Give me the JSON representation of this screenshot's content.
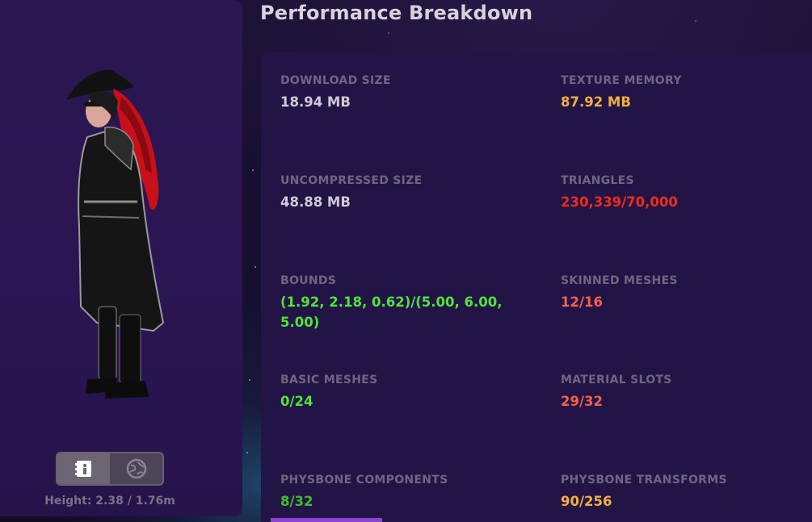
{
  "title": "Performance Breakdown",
  "avatar": {
    "height_label": "Height: 2.38 / 1.76m"
  },
  "toggle": {
    "info_icon": "info-card-icon",
    "globe_icon": "globe-icon"
  },
  "stats": [
    {
      "label": "DOWNLOAD SIZE",
      "value": "18.94 MB",
      "color": "#cfcbd4"
    },
    {
      "label": "TEXTURE MEMORY",
      "value": "87.92 MB",
      "color": "#f0b040"
    },
    {
      "label": "UNCOMPRESSED SIZE",
      "value": "48.88 MB",
      "color": "#cfcbd4"
    },
    {
      "label": "TRIANGLES",
      "value": "230,339/70,000",
      "color": "#ee2c1c"
    },
    {
      "label": "BOUNDS",
      "value": "(1.92, 2.18, 0.62)/(5.00, 6.00, 5.00)",
      "color": "#53e23a"
    },
    {
      "label": "SKINNED MESHES",
      "value": "12/16",
      "color": "#f3614c"
    },
    {
      "label": "BASIC MESHES",
      "value": "0/24",
      "color": "#53e23a"
    },
    {
      "label": "MATERIAL SLOTS",
      "value": "29/32",
      "color": "#f3614c"
    },
    {
      "label": "PHYSBONE COMPONENTS",
      "value": "8/32",
      "color": "#3fbd2b"
    },
    {
      "label": "PHYSBONE TRANSFORMS",
      "value": "90/256",
      "color": "#f0b040"
    }
  ]
}
